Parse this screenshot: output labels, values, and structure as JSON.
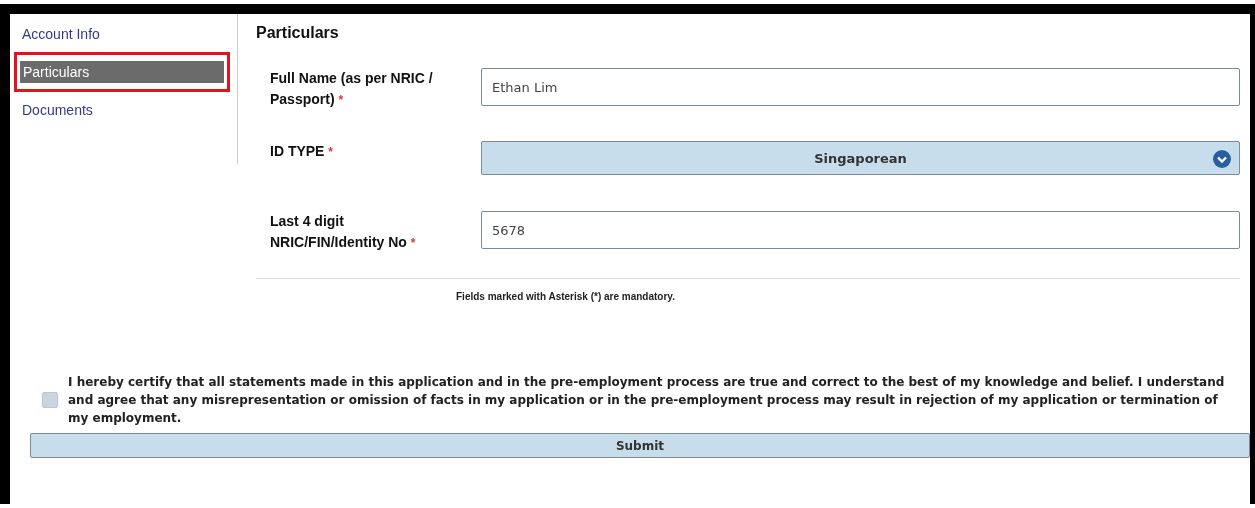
{
  "sidebar": {
    "items": [
      {
        "label": "Account Info",
        "selected": false
      },
      {
        "label": "Particulars",
        "selected": true
      },
      {
        "label": "Documents",
        "selected": false
      }
    ]
  },
  "form": {
    "title": "Particulars",
    "fields": [
      {
        "kind": "text",
        "label": "Full Name (as per NRIC / Passport)",
        "required_mark": "*",
        "value": "Ethan Lim"
      },
      {
        "kind": "select",
        "label": "ID TYPE",
        "required_mark": "*",
        "value": "Singaporean"
      },
      {
        "kind": "text",
        "label": "Last 4 digit NRIC/FIN/Identity No",
        "required_mark": "*",
        "value": "5678"
      }
    ],
    "note": "Fields marked with Asterisk (*) are mandatory."
  },
  "declaration": {
    "checked": false,
    "text": "I hereby certify that all statements made in this application and in the pre-employment process are true and correct to the best of my knowledge and belief. I understand and agree that any misrepresentation or omission of facts in my application or in the pre-employment process may result in rejection of my application or termination of my employment."
  },
  "submit": {
    "label": "Submit"
  }
}
